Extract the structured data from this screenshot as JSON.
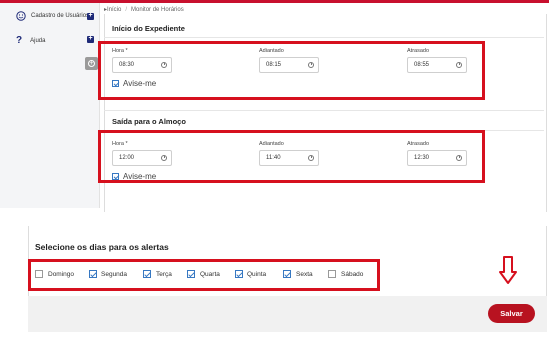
{
  "sidebar": {
    "items": [
      {
        "label": "Cadastro de Usuários",
        "icon": "smiley-icon"
      },
      {
        "label": "Ajuda",
        "icon": "question-icon"
      }
    ]
  },
  "breadcrumb": {
    "home": "Início",
    "current": "Monitor de Horários"
  },
  "start": {
    "title": "Início do Expediente",
    "hora_label": "Hora *",
    "hora_value": "08:30",
    "adiantado_label": "Adiantado",
    "adiantado_value": "08:15",
    "atrasado_label": "Atrasado",
    "atrasado_value": "08:55",
    "avise_label": "Avise-me"
  },
  "lunch": {
    "title": "Saída para o Almoço",
    "hora_label": "Hora *",
    "hora_value": "12:00",
    "adiantado_label": "Adiantado",
    "adiantado_value": "11:40",
    "atrasado_label": "Atrasado",
    "atrasado_value": "12:30",
    "avise_label": "Avise-me"
  },
  "days": {
    "title": "Selecione os dias para os alertas",
    "items": [
      {
        "label": "Domingo",
        "checked": false
      },
      {
        "label": "Segunda",
        "checked": true
      },
      {
        "label": "Terça",
        "checked": true
      },
      {
        "label": "Quarta",
        "checked": true
      },
      {
        "label": "Quinta",
        "checked": true
      },
      {
        "label": "Sexta",
        "checked": true
      },
      {
        "label": "Sábado",
        "checked": false
      }
    ]
  },
  "footer": {
    "save_label": "Salvar"
  },
  "colors": {
    "accent": "#c8102e",
    "highlight_box": "#d6101e",
    "checkbox": "#3778c2"
  }
}
